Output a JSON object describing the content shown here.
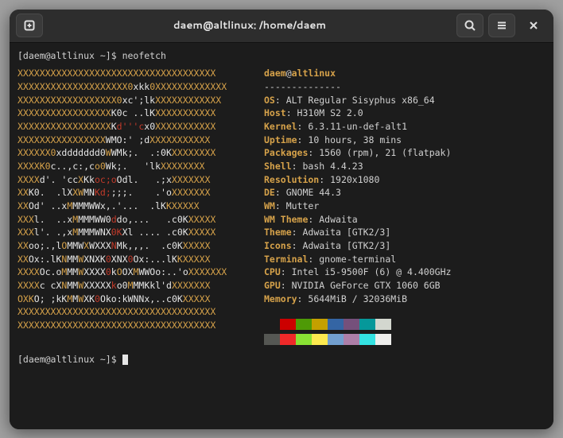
{
  "window": {
    "title": "daem@altlinux: /home/daem"
  },
  "prompt": {
    "line1_prefix": "[daem@altlinux ~]$ ",
    "command": "neofetch",
    "line2_prefix": "[daem@altlinux ~]$ "
  },
  "neofetch": {
    "user": "daem",
    "at": "@",
    "host": "altlinux",
    "separator": "--------------",
    "info": [
      {
        "key": "OS",
        "value": "ALT Regular Sisyphus x86_64"
      },
      {
        "key": "Host",
        "value": "H310M S2 2.0"
      },
      {
        "key": "Kernel",
        "value": "6.3.11-un-def-alt1"
      },
      {
        "key": "Uptime",
        "value": "10 hours, 38 mins"
      },
      {
        "key": "Packages",
        "value": "1560 (rpm), 21 (flatpak)"
      },
      {
        "key": "Shell",
        "value": "bash 4.4.23"
      },
      {
        "key": "Resolution",
        "value": "1920x1080"
      },
      {
        "key": "DE",
        "value": "GNOME 44.3"
      },
      {
        "key": "WM",
        "value": "Mutter"
      },
      {
        "key": "WM Theme",
        "value": "Adwaita"
      },
      {
        "key": "Theme",
        "value": "Adwaita [GTK2/3]"
      },
      {
        "key": "Icons",
        "value": "Adwaita [GTK2/3]"
      },
      {
        "key": "Terminal",
        "value": "gnome-terminal"
      },
      {
        "key": "CPU",
        "value": "Intel i5-9500F (6) @ 4.400GHz"
      },
      {
        "key": "GPU",
        "value": "NVIDIA GeForce GTX 1060 6GB"
      },
      {
        "key": "Memory",
        "value": "5644MiB / 32036MiB"
      }
    ],
    "logo_lines": [
      [
        [
          "o",
          "XXXXXXXXXXXXXXXXXXXXXXXXXXXXXXXXXXXX"
        ]
      ],
      [
        [
          "o",
          "XXXXXXXXXXXXXXXXXXXX0"
        ],
        [
          "w",
          "xkk"
        ],
        [
          "o",
          "0XXXXXXXXXXXXX"
        ]
      ],
      [
        [
          "o",
          "XXXXXXXXXXXXXXXXXX0"
        ],
        [
          "w",
          "xc';lk"
        ],
        [
          "o",
          "XXXXXXXXXXXX"
        ]
      ],
      [
        [
          "o",
          "XXXXXXXXXXXXXXXXX"
        ],
        [
          "w",
          "K0c ..lK"
        ],
        [
          "o",
          "XXXXXXXXXXX"
        ]
      ],
      [
        [
          "o",
          "XXXXXXXXXXXXXXXXX"
        ],
        [
          "w",
          "K"
        ],
        [
          "r",
          "d'''c"
        ],
        [
          "w",
          "x0"
        ],
        [
          "o",
          "XXXXXXXXXXX"
        ]
      ],
      [
        [
          "o",
          "XXXXXXXXXXXXXXXX"
        ],
        [
          "w",
          "WMO:' ;d"
        ],
        [
          "o",
          "XXXXXXXXXXX"
        ]
      ],
      [
        [
          "o",
          "XXXXXX0"
        ],
        [
          "w",
          "xddddddd0"
        ],
        [
          "o",
          "W"
        ],
        [
          "w",
          "WMk;.  .:0K"
        ],
        [
          "o",
          "XXXXXXXX"
        ]
      ],
      [
        [
          "o",
          "XXXXK0"
        ],
        [
          "w",
          "c..,c:,c"
        ],
        [
          "o",
          "o0"
        ],
        [
          "w",
          "Wk;.   'lk"
        ],
        [
          "o",
          "XXXXXXXX"
        ]
      ],
      [
        [
          "o",
          "XXXX"
        ],
        [
          "w",
          "d'. 'cc"
        ],
        [
          "o",
          "X"
        ],
        [
          "w",
          "Kk"
        ],
        [
          "r",
          "oc;o"
        ],
        [
          "w",
          "Odl.   .;x"
        ],
        [
          "o",
          "XXXXXXX"
        ]
      ],
      [
        [
          "o",
          "XX"
        ],
        [
          "w",
          "K0.  .lX"
        ],
        [
          "o",
          "XW"
        ],
        [
          "w",
          "MN"
        ],
        [
          "r",
          "Kd;"
        ],
        [
          "w",
          ";;;.    .'o"
        ],
        [
          "o",
          "XXXXXXX"
        ]
      ],
      [
        [
          "o",
          "XX"
        ],
        [
          "w",
          "Od' ..x"
        ],
        [
          "o",
          "M"
        ],
        [
          "w",
          "MMMWWx,.'...  .lK"
        ],
        [
          "o",
          "KXXXXX"
        ]
      ],
      [
        [
          "o",
          "XXX"
        ],
        [
          "w",
          "l.  ..x"
        ],
        [
          "o",
          "M"
        ],
        [
          "w",
          "MMMWW0"
        ],
        [
          "r",
          "d"
        ],
        [
          "w",
          "do,...   .c0K"
        ],
        [
          "o",
          "XXXXX"
        ]
      ],
      [
        [
          "o",
          "XXX"
        ],
        [
          "w",
          "l'. .,x"
        ],
        [
          "o",
          "M"
        ],
        [
          "w",
          "MMMWNX"
        ],
        [
          "r",
          "0K"
        ],
        [
          "w",
          "Xl .... .c0K"
        ],
        [
          "o",
          "XXXXX"
        ]
      ],
      [
        [
          "o",
          "XX"
        ],
        [
          "w",
          "oo;.,l"
        ],
        [
          "o",
          "O"
        ],
        [
          "w",
          "MMW"
        ],
        [
          "o",
          "X"
        ],
        [
          "w",
          "WXXX"
        ],
        [
          "r",
          "N"
        ],
        [
          "w",
          "Mk,,,.  .c0K"
        ],
        [
          "o",
          "XXXXX"
        ]
      ],
      [
        [
          "o",
          "XX"
        ],
        [
          "w",
          "Ox:.lK"
        ],
        [
          "o",
          "N"
        ],
        [
          "w",
          "MM"
        ],
        [
          "o",
          "W"
        ],
        [
          "w",
          "XNXK"
        ],
        [
          "r",
          "0"
        ],
        [
          "w",
          "XNX"
        ],
        [
          "r",
          "0"
        ],
        [
          "w",
          "Ox:...lK"
        ],
        [
          "o",
          "KXXXXX"
        ]
      ],
      [
        [
          "o",
          "XXXX"
        ],
        [
          "w",
          "Oc.o"
        ],
        [
          "o",
          "M"
        ],
        [
          "w",
          "MM"
        ],
        [
          "o",
          "W"
        ],
        [
          "w",
          "XXXX"
        ],
        [
          "r",
          "0"
        ],
        [
          "w",
          "k"
        ],
        [
          "o",
          "O"
        ],
        [
          "w",
          "OX"
        ],
        [
          "o",
          "M"
        ],
        [
          "w",
          "WWOo:..'o"
        ],
        [
          "o",
          "XXXXXXX"
        ]
      ],
      [
        [
          "o",
          "XXXX"
        ],
        [
          "w",
          "c cX"
        ],
        [
          "o",
          "N"
        ],
        [
          "w",
          "MM"
        ],
        [
          "o",
          "W"
        ],
        [
          "w",
          "XXXXX"
        ],
        [
          "r",
          "k"
        ],
        [
          "w",
          "o0"
        ],
        [
          "o",
          "M"
        ],
        [
          "w",
          "MMKkl'd"
        ],
        [
          "o",
          "XXXXXXX"
        ]
      ],
      [
        [
          "o",
          "OXK"
        ],
        [
          "w",
          "O; ;kK"
        ],
        [
          "o",
          "M"
        ],
        [
          "w",
          "M"
        ],
        [
          "o",
          "W"
        ],
        [
          "w",
          "XK"
        ],
        [
          "r",
          "0"
        ],
        [
          "w",
          "Oko:kWNNx,..c0K"
        ],
        [
          "o",
          "XXXXX"
        ]
      ],
      [
        [
          "o",
          "XXXXXXXXXXXXXXXXXXXXXXXXXXXXXXXXXXXX"
        ]
      ],
      [
        [
          "o",
          "XXXXXXXXXXXXXXXXXXXXXXXXXXXXXXXXXXXX"
        ]
      ]
    ],
    "swatches": [
      "#1c1c1c",
      "#cc0000",
      "#4e9a06",
      "#c4a000",
      "#3465a4",
      "#75507b",
      "#06989a",
      "#d3d7cf",
      "#555753",
      "#ef2929",
      "#8ae234",
      "#fce94f",
      "#729fcf",
      "#ad7fa8",
      "#34e2e2",
      "#eeeeec"
    ]
  }
}
